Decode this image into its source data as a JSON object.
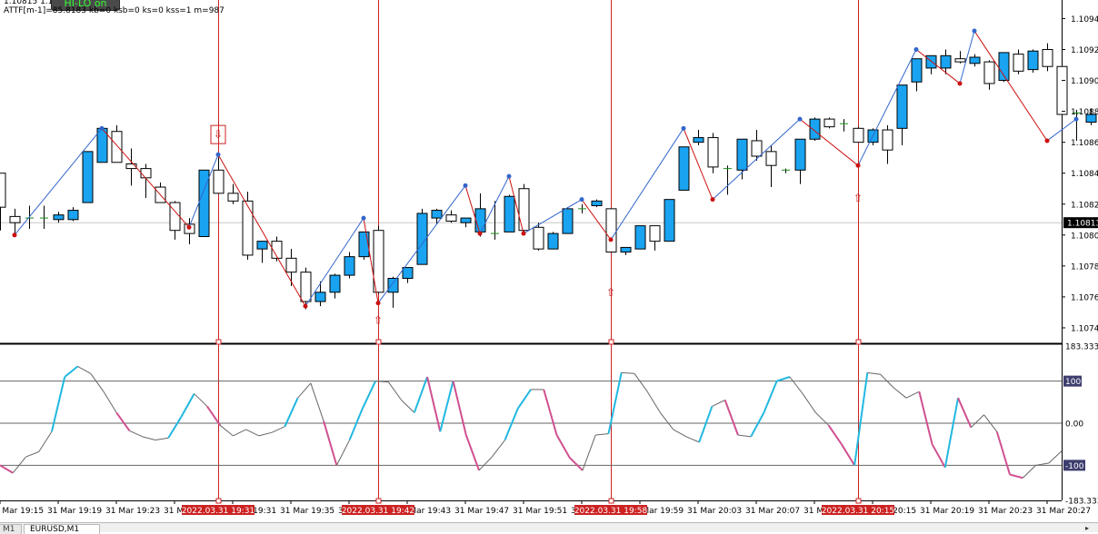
{
  "header": {
    "hilo_badge": "HI-LO on",
    "indicator_line": "ATTF[m-1]=85.8183 kb=0 ksb=0 ks=0 kss=1 m=987",
    "top_left_partial": "1.10815 1.1"
  },
  "tabs": {
    "prev_partial": "M1",
    "active": "EURUSD,M1"
  },
  "colors": {
    "bull": "#1aa3f0",
    "bear": "#ffffff",
    "zigzag_high_low": "#cc1111",
    "zigzag_low_high": "#3366cc",
    "vline": "#cc2222",
    "cci_up": "#22b8e0",
    "cci_down": "#d05090",
    "cci_flat": "#666666",
    "price_tag": "#000000"
  },
  "chart_data": [
    {
      "type": "candlestick",
      "symbol": "EURUSD",
      "timeframe": "M1",
      "ylim": [
        1.10735,
        1.10957
      ],
      "price_ticks": [
        "1.10945",
        "1.10925",
        "1.10905",
        "1.10885",
        "1.10865",
        "1.10845",
        "1.10825",
        "1.10805",
        "1.10785",
        "1.10765",
        "1.10745"
      ],
      "current_price_label": "1.10813",
      "current_price": 1.10813,
      "candles": [
        [
          1.10845,
          1.10845,
          1.10808,
          1.10823
        ],
        [
          1.10817,
          1.10822,
          1.10806,
          1.10813
        ],
        [
          1.10816,
          1.10824,
          1.10809,
          1.10816
        ],
        [
          1.10816,
          1.10824,
          1.10809,
          1.10816
        ],
        [
          1.10815,
          1.1082,
          1.10813,
          1.10818
        ],
        [
          1.10815,
          1.10823,
          1.10814,
          1.10821
        ],
        [
          1.10826,
          1.10859,
          1.10826,
          1.10859
        ],
        [
          1.10852,
          1.10875,
          1.10852,
          1.10874
        ],
        [
          1.10872,
          1.10876,
          1.10852,
          1.10852
        ],
        [
          1.10851,
          1.10861,
          1.10837,
          1.10848
        ],
        [
          1.10848,
          1.10851,
          1.10829,
          1.10842
        ],
        [
          1.10836,
          1.10839,
          1.10826,
          1.10826
        ],
        [
          1.10826,
          1.10827,
          1.10802,
          1.10808
        ],
        [
          1.10812,
          1.10816,
          1.10799,
          1.10806
        ],
        [
          1.10804,
          1.10847,
          1.10804,
          1.10847
        ],
        [
          1.10847,
          1.10855,
          1.10832,
          1.10832
        ],
        [
          1.10832,
          1.10838,
          1.10825,
          1.10827
        ],
        [
          1.10827,
          1.10833,
          1.10789,
          1.10792
        ],
        [
          1.10796,
          1.10799,
          1.10787,
          1.10801
        ],
        [
          1.10801,
          1.10804,
          1.10788,
          1.1079
        ],
        [
          1.1079,
          1.10796,
          1.10772,
          1.10781
        ],
        [
          1.10781,
          1.10784,
          1.10757,
          1.10762
        ],
        [
          1.10762,
          1.10775,
          1.10759,
          1.10768
        ],
        [
          1.10768,
          1.1078,
          1.10764,
          1.10779
        ],
        [
          1.10779,
          1.10794,
          1.10777,
          1.10791
        ],
        [
          1.10791,
          1.10807,
          1.10789,
          1.10807
        ],
        [
          1.10808,
          1.10811,
          1.10767,
          1.10768
        ],
        [
          1.10768,
          1.10778,
          1.10758,
          1.10777
        ],
        [
          1.10777,
          1.10784,
          1.10774,
          1.10784
        ],
        [
          1.10786,
          1.10822,
          1.10786,
          1.10819
        ],
        [
          1.10816,
          1.10822,
          1.10812,
          1.10821
        ],
        [
          1.10818,
          1.10821,
          1.10813,
          1.10814
        ],
        [
          1.10813,
          1.10816,
          1.1081,
          1.10816
        ],
        [
          1.10807,
          1.10832,
          1.10804,
          1.10822
        ],
        [
          1.10806,
          1.10827,
          1.10802,
          1.10806
        ],
        [
          1.10807,
          1.10831,
          1.10807,
          1.1083
        ],
        [
          1.10835,
          1.10838,
          1.10807,
          1.10808
        ],
        [
          1.1081,
          1.10813,
          1.10795,
          1.10796
        ],
        [
          1.10796,
          1.10807,
          1.10796,
          1.10806
        ],
        [
          1.10806,
          1.10823,
          1.10806,
          1.10822
        ],
        [
          1.10821,
          1.10825,
          1.10819,
          1.10822
        ],
        [
          1.10824,
          1.10828,
          1.10823,
          1.10827
        ],
        [
          1.10822,
          1.10822,
          1.10794,
          1.10794
        ],
        [
          1.10794,
          1.10797,
          1.10792,
          1.10797
        ],
        [
          1.10796,
          1.10811,
          1.10796,
          1.10811
        ],
        [
          1.10811,
          1.10811,
          1.10795,
          1.10801
        ],
        [
          1.10801,
          1.10828,
          1.10801,
          1.10828
        ],
        [
          1.10834,
          1.10862,
          1.10834,
          1.10862
        ],
        [
          1.10865,
          1.10873,
          1.10863,
          1.10868
        ],
        [
          1.10868,
          1.10871,
          1.10845,
          1.10849
        ],
        [
          1.10848,
          1.1085,
          1.10831,
          1.10848
        ],
        [
          1.10847,
          1.10867,
          1.10841,
          1.10867
        ],
        [
          1.10866,
          1.10873,
          1.10853,
          1.10856
        ],
        [
          1.10859,
          1.10863,
          1.10836,
          1.1085
        ],
        [
          1.10847,
          1.10848,
          1.10845,
          1.10847
        ],
        [
          1.10847,
          1.10867,
          1.10838,
          1.10867
        ],
        [
          1.10867,
          1.10881,
          1.10866,
          1.1088
        ],
        [
          1.1088,
          1.10881,
          1.10874,
          1.10875
        ],
        [
          1.10877,
          1.1088,
          1.10872,
          1.10877
        ],
        [
          1.10874,
          1.10875,
          1.10865,
          1.10865
        ],
        [
          1.10865,
          1.10874,
          1.10863,
          1.10873
        ],
        [
          1.10873,
          1.10876,
          1.10851,
          1.1086
        ],
        [
          1.10874,
          1.10902,
          1.10863,
          1.10902
        ],
        [
          1.10904,
          1.10919,
          1.10898,
          1.10919
        ],
        [
          1.10913,
          1.10919,
          1.10909,
          1.10921
        ],
        [
          1.10913,
          1.10925,
          1.10909,
          1.10921
        ],
        [
          1.10919,
          1.10924,
          1.10916,
          1.10917
        ],
        [
          1.10916,
          1.10922,
          1.10914,
          1.1092
        ],
        [
          1.10917,
          1.10918,
          1.10899,
          1.10903
        ],
        [
          1.10905,
          1.10923,
          1.10904,
          1.10923
        ],
        [
          1.10922,
          1.10925,
          1.10909,
          1.10911
        ],
        [
          1.10912,
          1.10925,
          1.1091,
          1.10924
        ],
        [
          1.10925,
          1.10929,
          1.10911,
          1.10914
        ],
        [
          1.10914,
          1.10915,
          1.10879,
          1.10883
        ],
        [
          1.10884,
          1.10886,
          1.10866,
          1.10883
        ],
        [
          1.10878,
          1.10887,
          1.10876,
          1.10883
        ],
        [
          1.10883,
          1.10892,
          1.10872,
          1.1089
        ]
      ],
      "zigzag": [
        [
          1.10805
        ],
        [
          1.10874
        ],
        [
          1.1081
        ],
        [
          1.10857
        ],
        [
          1.10759
        ],
        [
          1.10816
        ],
        [
          1.10761
        ],
        [
          1.10837
        ],
        [
          1.10806
        ],
        [
          1.10843
        ],
        [
          1.10806
        ],
        [
          1.10828
        ],
        [
          1.10802
        ],
        [
          1.10874
        ],
        [
          1.10828
        ],
        [
          1.1088
        ],
        [
          1.1085
        ],
        [
          1.10925
        ],
        [
          1.10903
        ],
        [
          1.10937
        ],
        [
          1.10866
        ],
        [
          1.1088
        ]
      ],
      "markers": [
        {
          "price": 1.1087,
          "type": "down-arrow-box"
        },
        {
          "price": 1.1075,
          "type": "up-arrow"
        },
        {
          "price": 1.10768,
          "type": "up-arrow"
        },
        {
          "price": 1.10829,
          "type": "up-arrow"
        }
      ],
      "vertical_lines": [
        "2022.03.31 19:31",
        "2022.03.31 19:42",
        "2022.03.31 19:58",
        "2022.03.31 20:15"
      ]
    },
    {
      "type": "line",
      "name": "CCI",
      "ylim": [
        -183.333,
        183.333
      ],
      "y_ticks": [
        "183.333",
        "100",
        "0.00",
        "-100",
        "-183.333"
      ],
      "levels": [
        100,
        0,
        -100
      ],
      "values": [
        -100,
        -118,
        -80,
        -68,
        -20,
        110,
        135,
        118,
        75,
        25,
        -18,
        -32,
        -40,
        -35,
        15,
        70,
        40,
        -5,
        -30,
        -15,
        -30,
        -22,
        -8,
        60,
        95,
        5,
        -100,
        -40,
        35,
        100,
        98,
        55,
        25,
        110,
        -20,
        100,
        -28,
        -112,
        -80,
        -40,
        35,
        80,
        80,
        -28,
        -82,
        -112,
        -28,
        -25,
        120,
        118,
        75,
        25,
        -15,
        -32,
        -45,
        40,
        55,
        -28,
        -32,
        25,
        100,
        110,
        70,
        25,
        -5,
        -50,
        -100,
        120,
        116,
        85,
        60,
        75,
        -50,
        -105,
        60,
        -10,
        20,
        -20,
        -122,
        -130,
        -100,
        -95,
        -66
      ]
    }
  ],
  "time_axis": {
    "labels": [
      "31 Mar 19:15",
      "31 Mar 19:19",
      "31 Mar 19:23",
      "31 Mar 19:27",
      "31 Mar 19:31",
      "31 Mar 19:35",
      "31 Mar 19:39",
      "31 Mar 19:43",
      "31 Mar 19:47",
      "31 Mar 19:51",
      "31 Mar 19:55",
      "31 Mar 19:59",
      "31 Mar 20:03",
      "31 Mar 20:07",
      "31 Mar 20:11",
      "31 Mar 20:15",
      "31 Mar 20:19",
      "31 Mar 20:23",
      "31 Mar 20:27"
    ],
    "highlight_labels": [
      "2022.03.31 19:31",
      "2022.03.31 19:42",
      "2022.03.31 19:58",
      "2022.03.31 20:15"
    ]
  }
}
